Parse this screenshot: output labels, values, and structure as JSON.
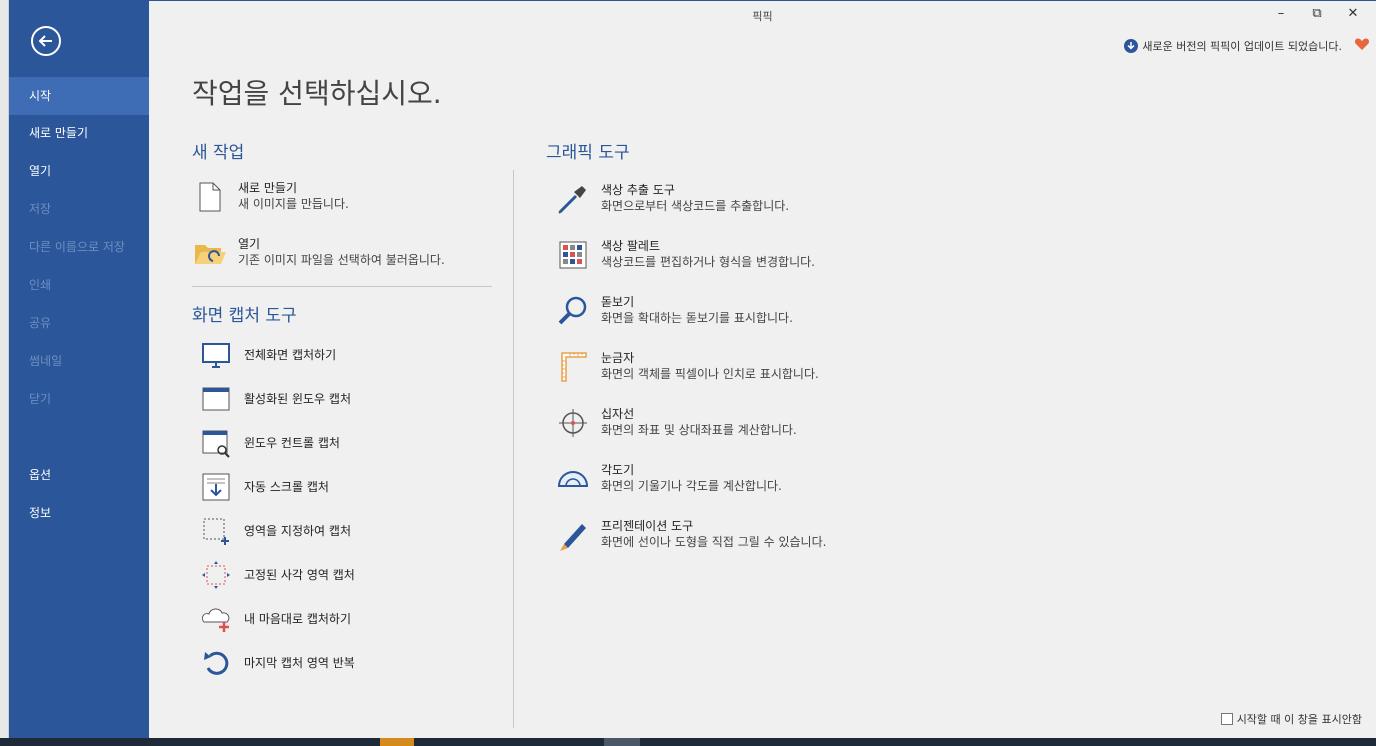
{
  "window": {
    "title": "픽픽",
    "minimize_glyph": "–",
    "restore_glyph": "⧉",
    "close_glyph": "✕"
  },
  "sidebar": {
    "items": [
      {
        "label": "시작",
        "state": "active"
      },
      {
        "label": "새로 만들기",
        "state": "normal"
      },
      {
        "label": "열기",
        "state": "normal"
      },
      {
        "label": "저장",
        "state": "disabled"
      },
      {
        "label": "다른 이름으로 저장",
        "state": "disabled"
      },
      {
        "label": "인쇄",
        "state": "disabled"
      },
      {
        "label": "공유",
        "state": "disabled"
      },
      {
        "label": "썸네일",
        "state": "disabled"
      },
      {
        "label": "닫기",
        "state": "disabled"
      },
      {
        "label": "옵션",
        "state": "normal"
      },
      {
        "label": "정보",
        "state": "normal"
      }
    ]
  },
  "update_notice": "새로운 버전의 픽픽이 업데이트 되었습니다.",
  "main_title": "작업을 선택하십시오.",
  "new_task": {
    "title": "새 작업",
    "items": [
      {
        "label": "새로 만들기",
        "desc": "새 이미지를 만듭니다.",
        "icon": "new-file-icon"
      },
      {
        "label": "열기",
        "desc": "기존 이미지 파일을 선택하여 불러옵니다.",
        "icon": "open-folder-icon"
      }
    ]
  },
  "capture": {
    "title": "화면 캡처 도구",
    "items": [
      {
        "label": "전체화면 캡처하기",
        "icon": "monitor-icon"
      },
      {
        "label": "활성화된 윈도우 캡처",
        "icon": "window-icon"
      },
      {
        "label": "윈도우 컨트롤 캡처",
        "icon": "window-control-icon"
      },
      {
        "label": "자동 스크롤 캡처",
        "icon": "scroll-capture-icon"
      },
      {
        "label": "영역을 지정하여 캡처",
        "icon": "region-capture-icon"
      },
      {
        "label": "고정된 사각 영역 캡처",
        "icon": "fixed-region-icon"
      },
      {
        "label": "내 마음대로 캡처하기",
        "icon": "freehand-capture-icon"
      },
      {
        "label": "마지막 캡처 영역 반복",
        "icon": "repeat-capture-icon"
      }
    ]
  },
  "graphic": {
    "title": "그래픽 도구",
    "items": [
      {
        "label": "색상 추출 도구",
        "desc": "화면으로부터 색상코드를 추출합니다.",
        "icon": "eyedropper-icon"
      },
      {
        "label": "색상 팔레트",
        "desc": "색상코드를 편집하거나 형식을 변경합니다.",
        "icon": "palette-icon"
      },
      {
        "label": "돋보기",
        "desc": "화면을 확대하는 돋보기를 표시합니다.",
        "icon": "magnifier-icon"
      },
      {
        "label": "눈금자",
        "desc": "화면의 객체를 픽셀이나 인치로 표시합니다.",
        "icon": "ruler-icon"
      },
      {
        "label": "십자선",
        "desc": "화면의 좌표 및 상대좌표를 계산합니다.",
        "icon": "crosshair-icon"
      },
      {
        "label": "각도기",
        "desc": "화면의 기울기나 각도를 계산합니다.",
        "icon": "protractor-icon"
      },
      {
        "label": "프리젠테이션 도구",
        "desc": "화면에 선이나 도형을 직접 그릴 수 있습니다.",
        "icon": "pen-icon"
      }
    ]
  },
  "dont_show_label": "시작할 때 이 창을 표시안함",
  "colors": {
    "sidebar": "#2b579a",
    "sidebar_active": "#3e6db5",
    "accent": "#2b579a",
    "heart": "#e8663d"
  }
}
